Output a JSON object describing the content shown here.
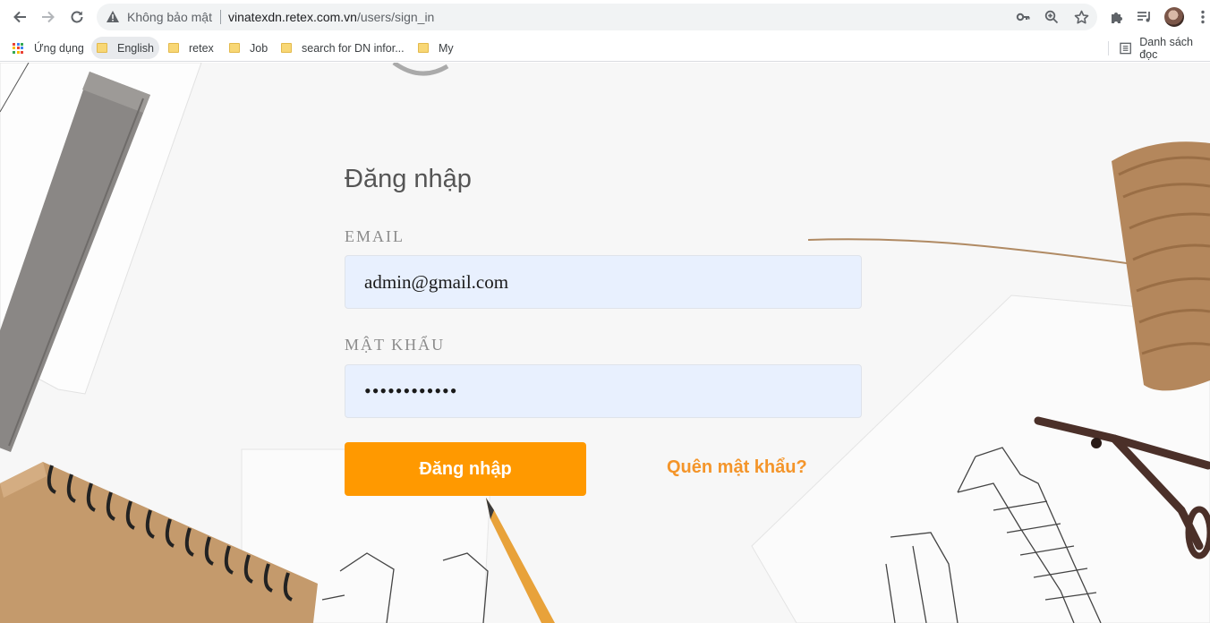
{
  "browser": {
    "security_text": "Không bảo mật",
    "url_host": "vinatexdn.retex.com.vn",
    "url_path": "/users/sign_in",
    "bookmarks": {
      "apps_label": "Ứng dụng",
      "items": [
        "English",
        "retex",
        "Job",
        "search for DN infor...",
        "My"
      ],
      "reading_list_label": "Danh sách đọc"
    },
    "icons": {
      "back": "back-arrow-icon",
      "forward": "forward-arrow-icon",
      "reload": "reload-icon",
      "warning": "warning-icon",
      "key": "key-icon",
      "zoom": "zoom-icon",
      "star": "star-icon",
      "extensions": "puzzle-icon",
      "media": "media-queue-icon",
      "menu": "kebab-menu-icon"
    }
  },
  "login": {
    "title": "Đăng nhập",
    "email_label": "EMAIL",
    "email_value": "admin@gmail.com",
    "password_label": "MẬT KHẨU",
    "password_value": "••••••••••••",
    "submit_label": "Đăng nhập",
    "forgot_label": "Quên mật khẩu?"
  },
  "colors": {
    "accent": "#ff9900",
    "link": "#f4952a",
    "input_bg": "#e8f0fe",
    "title": "#555555",
    "label": "#8b8b8b"
  }
}
